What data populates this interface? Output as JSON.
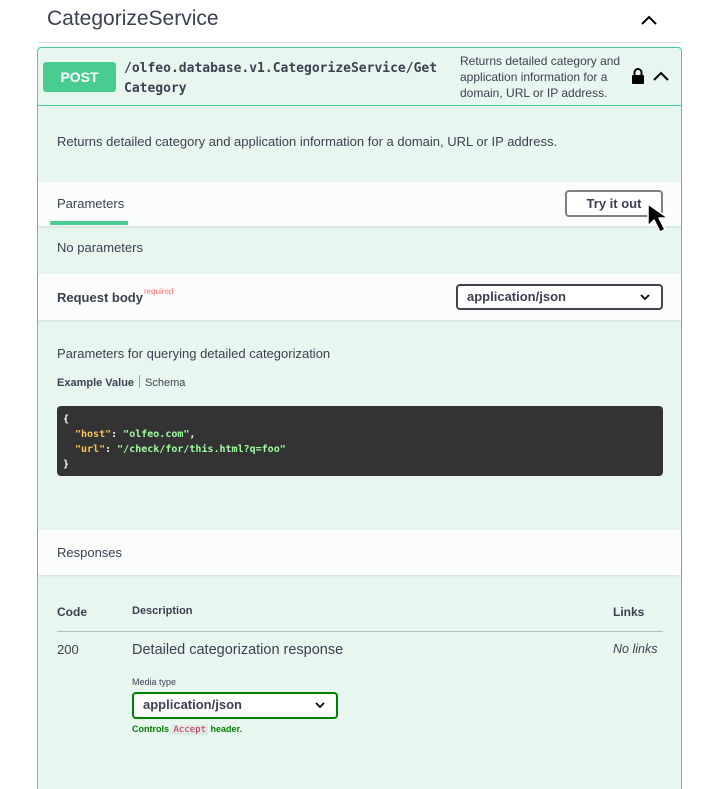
{
  "tag": {
    "title": "CategorizeService"
  },
  "operation": {
    "method": "POST",
    "path": "/olfeo.database.v1.CategorizeService/GetCategory",
    "summary": "Returns detailed category and application information for a domain, URL or IP address.",
    "description": "Returns detailed category and application information for a domain, URL or IP address."
  },
  "parameters": {
    "tab_label": "Parameters",
    "try_label": "Try it out",
    "empty_text": "No parameters"
  },
  "request_body": {
    "title": "Request body",
    "required_label": "required",
    "content_type": "application/json",
    "description": "Parameters for querying detailed categorization",
    "tab_example": "Example Value",
    "tab_schema": "Schema",
    "example": {
      "open": "{",
      "host_key": "\"host\"",
      "host_value": "\"olfeo.com\"",
      "url_key": "\"url\"",
      "url_value": "\"/check/for/this.html?q=foo\"",
      "close": "}"
    }
  },
  "responses": {
    "title": "Responses",
    "col_code": "Code",
    "col_description": "Description",
    "col_links": "Links",
    "rows": [
      {
        "code": "200",
        "description": "Detailed categorization response",
        "links": "No links",
        "media_type_label": "Media type",
        "media_type": "application/json",
        "controls_prefix": "Controls",
        "controls_code": "Accept",
        "controls_suffix": "header."
      }
    ]
  },
  "colors": {
    "post": "#49cc90",
    "post_bg": "#e8f6f0",
    "required": "#ff6f6f",
    "code_bg": "#333333"
  }
}
